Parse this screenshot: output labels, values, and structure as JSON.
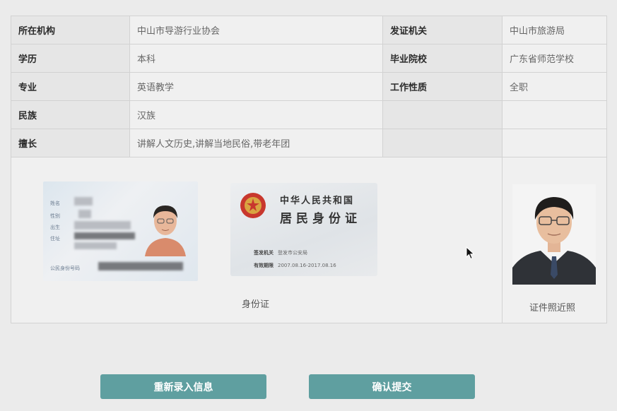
{
  "info_rows": [
    {
      "label1": "所在机构",
      "value1": "中山市导游行业协会",
      "label2": "发证机关",
      "value2": "中山市旅游局"
    },
    {
      "label1": "学历",
      "value1": "本科",
      "label2": "毕业院校",
      "value2": "广东省师范学校"
    },
    {
      "label1": "专业",
      "value1": "英语教学",
      "label2": "工作性质",
      "value2": "全职"
    },
    {
      "label1": "民族",
      "value1": "汉族"
    },
    {
      "label1": "擅长",
      "value1": "讲解人文历史,讲解当地民俗,带老年团"
    }
  ],
  "id_card": {
    "front_field_labels": [
      "姓名",
      "性别",
      "出生",
      "住址"
    ],
    "front_id_label": "公民身份号码",
    "back_country": "中华人民共和国",
    "back_title": "居民身份证",
    "back_authority_label": "签发机关",
    "back_authority_value": "登发市公安局",
    "back_validity_label": "有效期限",
    "back_validity_value": "2007.08.16-2017.08.16",
    "caption": "身份证"
  },
  "photo_caption": "证件照近照",
  "buttons": {
    "reenter": "重新录入信息",
    "confirm": "确认提交"
  },
  "colors": {
    "button": "#5f9fa0",
    "emblem": "#c8372d"
  }
}
